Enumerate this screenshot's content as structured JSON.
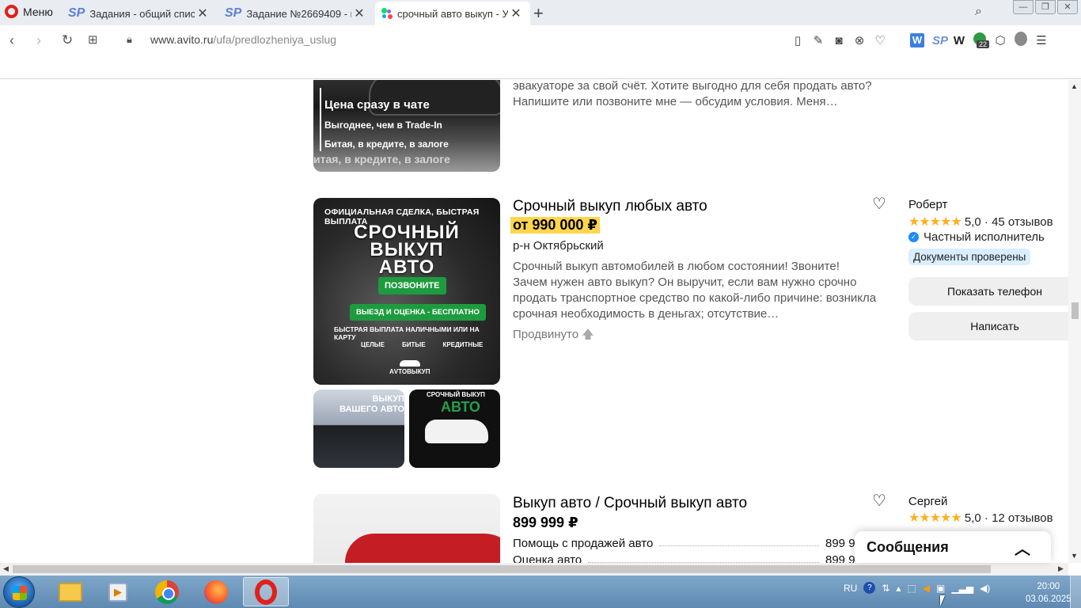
{
  "browser": {
    "menu_label": "Меню",
    "tabs": [
      {
        "label": "Задания - общий список з",
        "favicon": "sp-icon"
      },
      {
        "label": "Задание №2669409 - про",
        "favicon": "sp-icon"
      },
      {
        "label": "срочный авто выкуп - Усл",
        "favicon": "avito-icon"
      }
    ],
    "url_domain": "www.avito.ru",
    "url_path": "/ufa/predlozheniya_uslug",
    "extension_badge": "22"
  },
  "listings": [
    {
      "image_text": {
        "line1": "Цена сразу в чате",
        "line2": "Выгоднее, чем в Trade-In",
        "line3": "Битая, в кредите, в залоге",
        "line4": "итая, в кредите, в залоге"
      },
      "description": "эвакуаторе за свой счёт. Хотите выгодно для себя продать авто? Напишите или позвоните мне — обсудим условия. Меня…"
    },
    {
      "title": "Срочный выкуп любых авто",
      "price": "от 990 000 ₽",
      "region": "р-н Октябрьский",
      "description": "Срочный выкуп автомобилей в любом состоянии! Звоните! Зачем нужен авто выкуп? Он выручит, если вам нужно срочно продать транспортное средство по какой-либо причине: возникла срочная необходимость в деньгах; отсутствие…",
      "promoted": "Продвинуто",
      "seller": "Роберт",
      "stars": "★★★★★",
      "rating": "5,0 · 45 отзывов",
      "seller_type": "Частный исполнитель",
      "docs_badge": "Документы проверены",
      "show_phone": "Показать телефон",
      "write": "Написать",
      "image_text": {
        "top": "ОФИЦИАЛЬНАЯ СДЕЛКА, БЫСТРАЯ ВЫПЛАТА",
        "big1": "СРОЧНЫЙ",
        "big2": "ВЫКУП",
        "big3": "АВТО",
        "call": "ПОЗВОНИТЕ",
        "free": "ВЫЕЗД И ОЦЕНКА - БЕСПЛАТНО",
        "pay": "БЫСТРАЯ ВЫПЛАТА НАЛИЧНЫМИ ИЛИ НА КАРТУ",
        "tag1": "ЦЕЛЫЕ",
        "tag2": "БИТЫЕ",
        "tag3": "КРЕДИТНЫЕ",
        "logo": "АVTOВЫКУП"
      },
      "thumb1_text": "ВЫКУП ВАШЕГО АВТО",
      "thumb2_text": "СРОЧНЫЙ ВЫКУП",
      "thumb2_big": "АВТО"
    },
    {
      "title": "Выкуп авто / Срочный выкуп авто",
      "price": "899 999 ₽",
      "seller": "Сергей",
      "stars": "★★★★★",
      "rating": "5,0 · 12 отзывов",
      "services": [
        {
          "label": "Помощь с продажей авто",
          "value": "899 9"
        },
        {
          "label": "Оценка авто",
          "value": "899 9"
        }
      ]
    }
  ],
  "messages_panel": {
    "title": "Сообщения"
  },
  "taskbar": {
    "lang": "RU",
    "time": "20:00",
    "date": "03.06.2025"
  }
}
